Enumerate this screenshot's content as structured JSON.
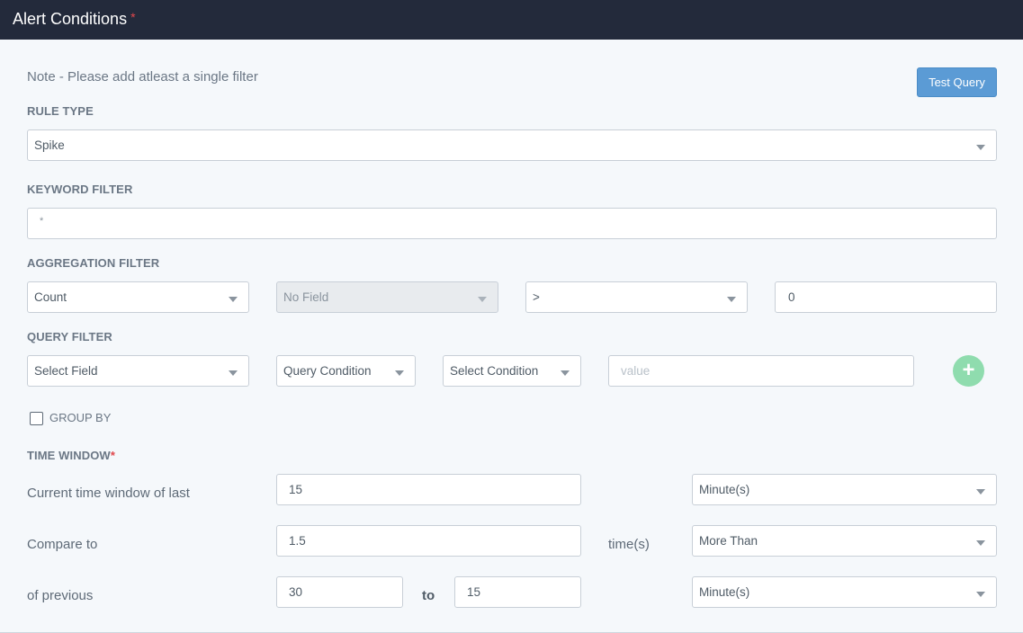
{
  "header": {
    "title": "Alert Conditions",
    "required_mark": "*"
  },
  "note": "Note - Please add atleast a single filter",
  "test_query_label": "Test Query",
  "rule_type": {
    "label": "RULE TYPE",
    "value": "Spike"
  },
  "keyword_filter": {
    "label": "KEYWORD FILTER",
    "value": "*"
  },
  "aggregation_filter": {
    "label": "AGGREGATION FILTER",
    "function": "Count",
    "field": "No Field",
    "operator": ">",
    "value": "0"
  },
  "query_filter": {
    "label": "QUERY FILTER",
    "field_placeholder": "Select Field",
    "query_condition": "Query Condition",
    "condition": "Select Condition",
    "value_placeholder": "value",
    "add_icon": "+"
  },
  "group_by": {
    "label": "GROUP BY",
    "checked": false
  },
  "time_window": {
    "label": "TIME WINDOW",
    "required_mark": "*",
    "current_label": "Current time window of last",
    "current_value": "15",
    "current_unit": "Minute(s)",
    "compare_label": "Compare to",
    "compare_value": "1.5",
    "times_label": "time(s)",
    "compare_mode": "More Than",
    "previous_label": "of previous",
    "previous_from": "30",
    "to_label": "to",
    "previous_to": "15",
    "previous_unit": "Minute(s)"
  }
}
